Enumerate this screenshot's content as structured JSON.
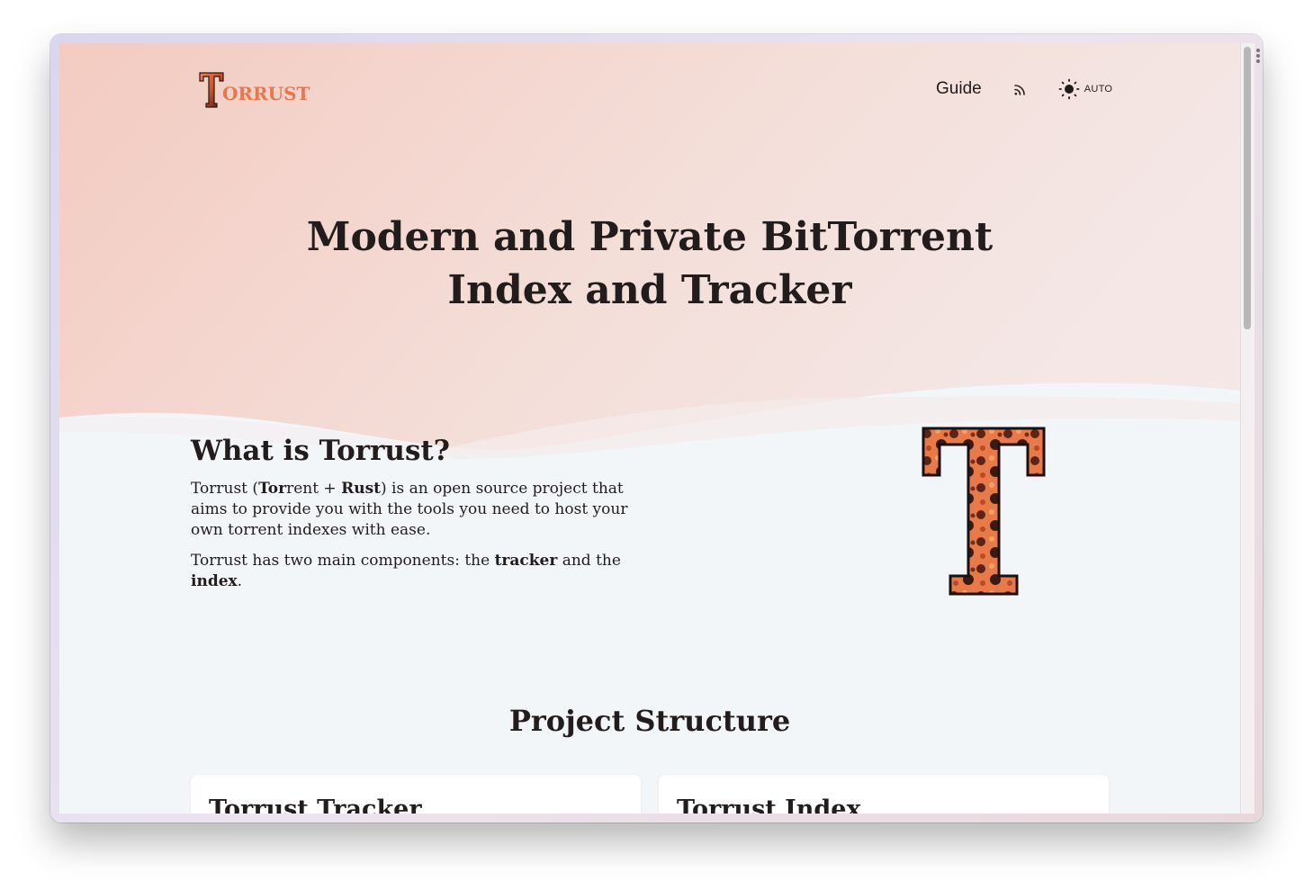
{
  "header": {
    "logo_initial": "T",
    "logo_text": "ORRUST",
    "nav_guide": "Guide",
    "rss_icon": "rss-icon",
    "theme_icon": "sun-icon",
    "theme_label": "AUTO"
  },
  "hero": {
    "title_line1": "Modern and Private BitTorrent",
    "title_line2": "Index and Tracker"
  },
  "about": {
    "title": "What is Torrust?",
    "p1_a": "Torrust (",
    "p1_b": "Tor",
    "p1_c": "rent + ",
    "p1_d": "Rust",
    "p1_e": ") is an open source project that aims to provide you with the tools you need to host your own torrent indexes with ease.",
    "p2_a": "Torrust has two main components: the ",
    "p2_b": "tracker",
    "p2_c": " and the ",
    "p2_d": "index",
    "p2_e": "."
  },
  "structure": {
    "title": "Project Structure",
    "cards": [
      {
        "title": "Torrust Tracker"
      },
      {
        "title": "Torrust Index"
      }
    ]
  },
  "colors": {
    "brand": "#e8784c",
    "text": "#231c1c",
    "hero_bg": "#f5d6cf",
    "page_bg": "#f3f6f9"
  }
}
